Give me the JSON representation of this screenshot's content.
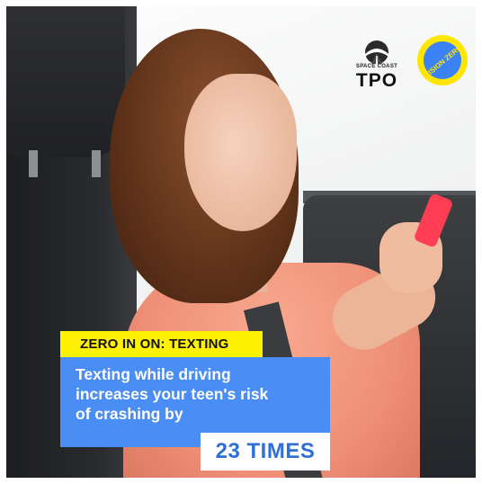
{
  "logos": {
    "tpo": {
      "small_text": "SPACE COAST",
      "big_text": "TPO"
    },
    "vision_zero": {
      "text": "VISION ZERO",
      "ring_color": "#ffe600",
      "inner_color": "#3b82f6"
    }
  },
  "headline_tag": "ZERO IN ON: TEXTING",
  "message": {
    "line1": "Texting while driving",
    "line2": "increases your teen's risk",
    "line3": "of crashing by"
  },
  "statistic": "23 TIMES",
  "colors": {
    "tag_bg": "#fff200",
    "panel_bg": "#4a8df5",
    "stat_text": "#2f6fd6"
  }
}
